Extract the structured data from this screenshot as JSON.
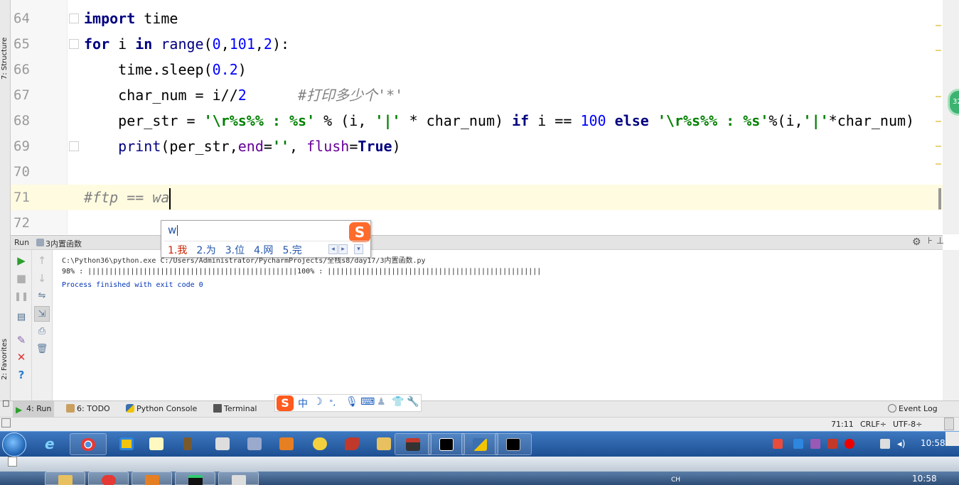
{
  "side_tabs": {
    "structure": "7: Structure",
    "favorites": "2: Favorites"
  },
  "editor": {
    "lines": [
      {
        "num": "64",
        "tokens": [
          {
            "t": "import",
            "c": "kw"
          },
          {
            "t": " time",
            "c": ""
          }
        ]
      },
      {
        "num": "65",
        "tokens": [
          {
            "t": "for",
            "c": "kw"
          },
          {
            "t": " i ",
            "c": ""
          },
          {
            "t": "in",
            "c": "kw"
          },
          {
            "t": " ",
            "c": ""
          },
          {
            "t": "range",
            "c": "blt"
          },
          {
            "t": "(",
            "c": ""
          },
          {
            "t": "0",
            "c": "num"
          },
          {
            "t": ",",
            "c": ""
          },
          {
            "t": "101",
            "c": "num"
          },
          {
            "t": ",",
            "c": ""
          },
          {
            "t": "2",
            "c": "num"
          },
          {
            "t": "):",
            "c": ""
          }
        ]
      },
      {
        "num": "66",
        "tokens": [
          {
            "t": "    time.sleep(",
            "c": ""
          },
          {
            "t": "0.2",
            "c": "num"
          },
          {
            "t": ")",
            "c": ""
          }
        ]
      },
      {
        "num": "67",
        "tokens": [
          {
            "t": "    char_num = i//",
            "c": ""
          },
          {
            "t": "2",
            "c": "num"
          },
          {
            "t": "      ",
            "c": ""
          },
          {
            "t": "#打印多少个'*'",
            "c": "cmt"
          }
        ]
      },
      {
        "num": "68",
        "tokens": [
          {
            "t": "    per_str = ",
            "c": ""
          },
          {
            "t": "'\\r%s%% : %s'",
            "c": "str"
          },
          {
            "t": " % (i, ",
            "c": ""
          },
          {
            "t": "'|'",
            "c": "str"
          },
          {
            "t": " * char_num) ",
            "c": ""
          },
          {
            "t": "if",
            "c": "kw"
          },
          {
            "t": " i == ",
            "c": ""
          },
          {
            "t": "100",
            "c": "num"
          },
          {
            "t": " ",
            "c": ""
          },
          {
            "t": "else",
            "c": "kw"
          },
          {
            "t": " ",
            "c": ""
          },
          {
            "t": "'\\r%s%% : %s'",
            "c": "str"
          },
          {
            "t": "%(i,",
            "c": ""
          },
          {
            "t": "'|'",
            "c": "str"
          },
          {
            "t": "*char_num)",
            "c": ""
          }
        ]
      },
      {
        "num": "69",
        "tokens": [
          {
            "t": "    ",
            "c": ""
          },
          {
            "t": "print",
            "c": "blt"
          },
          {
            "t": "(per_str,",
            "c": ""
          },
          {
            "t": "end",
            "c": "kwarg"
          },
          {
            "t": "=",
            "c": ""
          },
          {
            "t": "''",
            "c": "str"
          },
          {
            "t": ", ",
            "c": ""
          },
          {
            "t": "flush",
            "c": "kwarg"
          },
          {
            "t": "=",
            "c": ""
          },
          {
            "t": "True",
            "c": "kw"
          },
          {
            "t": ")",
            "c": ""
          }
        ]
      },
      {
        "num": "70",
        "tokens": []
      },
      {
        "num": "71",
        "tokens": [
          {
            "t": "#ftp == wa",
            "c": "cmt"
          }
        ]
      },
      {
        "num": "72",
        "tokens": []
      }
    ],
    "notification_count": "32"
  },
  "ime_popup": {
    "input": "w",
    "logo": "S",
    "candidates": [
      "1.我",
      "2.为",
      "3.位",
      "4.网",
      "5.完"
    ]
  },
  "run_panel": {
    "label": "Run",
    "config_name": "3内置函数",
    "console_lines": [
      "C:\\Python36\\python.exe C:/Users/Administrator/PycharmProjects/全栈s8/day17/3内置函数.py",
      "98% : |||||||||||||||||||||||||||||||||||||||||||||||||100% : ||||||||||||||||||||||||||||||||||||||||||||||||||",
      "Process finished with exit code 0"
    ]
  },
  "tool_tabs": {
    "run": "4: Run",
    "todo": "6: TODO",
    "python_console": "Python Console",
    "terminal": "Terminal",
    "event_log": "Event Log"
  },
  "sogou_toolbar": {
    "logo": "S",
    "mode": "中",
    "moon": "☽",
    "punct": "°,"
  },
  "status_bar": {
    "position": "71:11",
    "line_sep": "CRLF÷",
    "encoding": "UTF-8÷"
  },
  "taskbar": {
    "time": "10:58",
    "time2": "10:58",
    "lang": "CH"
  },
  "colors": {
    "keyword": "#000080",
    "number": "#0000ff",
    "string": "#008000",
    "comment": "#808080",
    "current_line": "#fffbe0",
    "taskbar": "#2b5ea6"
  }
}
